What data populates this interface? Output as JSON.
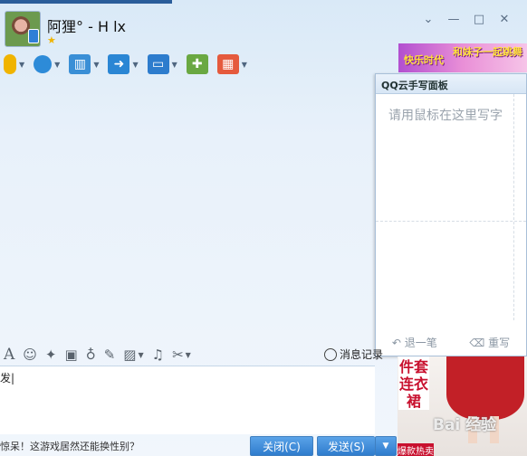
{
  "contact": {
    "name": "阿狸° - H lx",
    "status_icon": "star-icon"
  },
  "window_controls": [
    "chevron-down-icon",
    "minimize-icon",
    "maximize-icon",
    "close-icon"
  ],
  "toolbar": [
    {
      "icon": "microphone-icon",
      "color": "#f0b400"
    },
    {
      "icon": "webcam-icon",
      "color": "#2d8bd8"
    },
    {
      "icon": "screen-share-icon",
      "color": "#3a8fd6"
    },
    {
      "icon": "transfer-file-icon",
      "color": "#2a86d4"
    },
    {
      "icon": "remote-desktop-icon",
      "color": "#2d7ccd"
    },
    {
      "icon": "create-discussion-icon",
      "color": "#6aa842"
    },
    {
      "icon": "apps-icon",
      "color": "#e55a3d"
    }
  ],
  "handwriting": {
    "title": "QQ云手写面板",
    "placeholder": "请用鼠标在这里写字",
    "undo": "退一笔",
    "rewrite": "重写"
  },
  "ad": {
    "top_text_left": "快乐时代",
    "top_text_right": "和妹子一起跳舞",
    "side_text": "件套连衣裙",
    "side_tag": "爆款热卖",
    "watermark": "Bai 经验"
  },
  "format_bar": [
    "font-icon",
    "emoji-icon",
    "magic-icon",
    "shake-icon",
    "voice-message-icon",
    "note-icon",
    "image-icon",
    "music-icon",
    "screenshot-icon"
  ],
  "message_record": "消息记录",
  "input": {
    "text": "发|"
  },
  "bottom": {
    "tip": "惊呆！这游戏居然还能换性别？",
    "close_label": "关闭(C)",
    "send_label": "发送(S)"
  }
}
